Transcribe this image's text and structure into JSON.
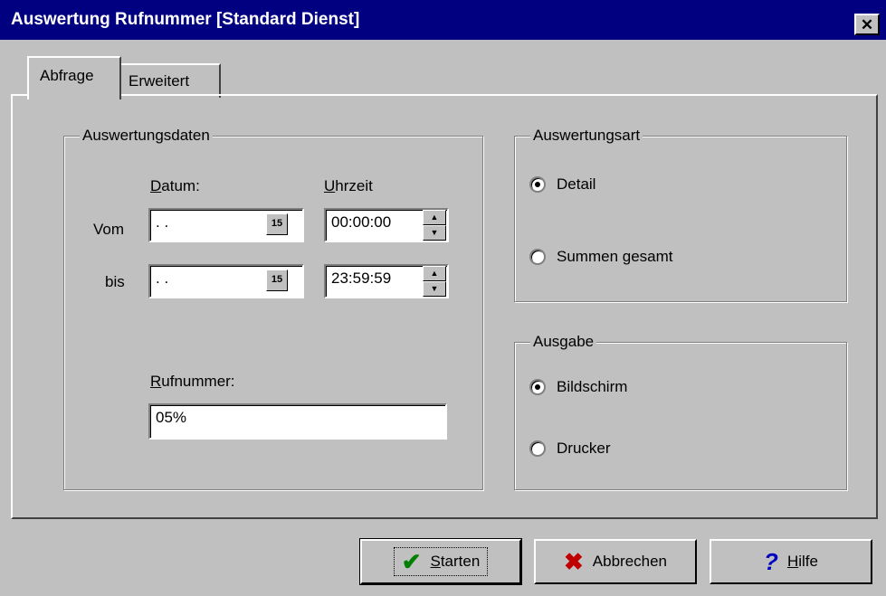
{
  "window": {
    "title": "Auswertung Rufnummer [Standard Dienst]",
    "close_glyph": "✕"
  },
  "tabs": [
    {
      "label": "Abfrage",
      "active": true
    },
    {
      "label": "Erweitert",
      "active": false
    }
  ],
  "auswertungsdaten": {
    "legend": "Auswertungsdaten",
    "datum_label": "Datum:",
    "uhrzeit_label": "Uhrzeit",
    "vom_label": "Vom",
    "bis_label": "bis",
    "vom_date": " . .",
    "bis_date": " . .",
    "calendar_glyph": "15",
    "vom_time": "00:00:00",
    "bis_time": "23:59:59",
    "rufnummer_label": "Rufnummer:",
    "rufnummer_value": "05%"
  },
  "auswertungsart": {
    "legend": "Auswertungsart",
    "options": [
      {
        "label": "Detail",
        "selected": true
      },
      {
        "label": "Summen gesamt",
        "selected": false
      }
    ]
  },
  "ausgabe": {
    "legend": "Ausgabe",
    "options": [
      {
        "label": "Bildschirm",
        "selected": true
      },
      {
        "label": "Drucker",
        "selected": false
      }
    ]
  },
  "buttons": {
    "starten": "Starten",
    "abbrechen": "Abbrechen",
    "hilfe": "Hilfe"
  },
  "icons": {
    "starten": "check-icon",
    "abbrechen": "x-icon",
    "hilfe": "question-icon"
  },
  "colors": {
    "titlebar": "#000080",
    "check": "#008000",
    "x": "#c00000",
    "help": "#0000c0"
  }
}
